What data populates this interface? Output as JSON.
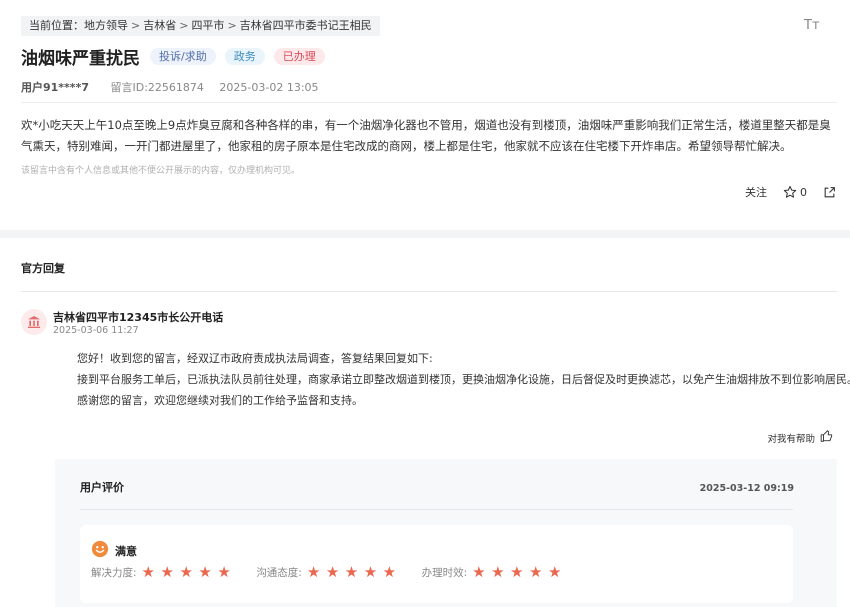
{
  "breadcrumb": {
    "prefix": "当前位置：",
    "items": [
      "地方领导",
      "吉林省",
      "四平市",
      "吉林省四平市委书记王相民"
    ],
    "separator": ">"
  },
  "toolbar": {
    "font_size_icon": "Tт"
  },
  "message": {
    "title": "油烟味严重扰民",
    "tags": {
      "type": "投诉/求助",
      "dept": "政务",
      "status": "已办理"
    },
    "user": "用户91****7",
    "message_id": "留言ID:22561874",
    "time": "2025-03-02 13:05",
    "content": "欢*小吃天天上午10点至晚上9点炸臭豆腐和各种各样的串，有一个油烟净化器也不管用，烟道也没有到楼顶，油烟味严重影响我们正常生活，楼道里整天都是臭气熏天，特别难闻，一开门都进屋里了，他家租的房子原本是住宅改成的商网，楼上都是住宅，他家就不应该在住宅楼下开炸串店。希望领导帮忙解决。",
    "privacy_note": "该留言中含有个人信息或其他不便公开展示的内容，仅办理机构可见。",
    "actions": {
      "follow": "关注",
      "like_count": "0"
    }
  },
  "official_reply": {
    "section_title": "官方回复",
    "org_name": "吉林省四平市12345市长公开电话",
    "time": "2025-03-06 11:27",
    "lines": [
      "您好！收到您的留言，经双辽市政府责成执法局调查，答复结果回复如下:",
      "接到平台服务工单后，已派执法队员前往处理，商家承诺立即整改烟道到楼顶，更换油烟净化设施，日后督促及时更换滤芯，以免产生油烟排放不到位影响居民。",
      "感谢您的留言，欢迎您继续对我们的工作给予监督和支持。"
    ],
    "helpful_label": "对我有帮助"
  },
  "evaluation": {
    "title": "用户评价",
    "time": "2025-03-12 09:19",
    "satisfaction": "满意",
    "ratings": [
      {
        "label": "解决力度:",
        "stars": 5
      },
      {
        "label": "沟通态度:",
        "stars": 5
      },
      {
        "label": "办理时效:",
        "stars": 5
      }
    ]
  },
  "colors": {
    "accent_red": "#d94b5b",
    "star": "#e9684f",
    "tag_blue": "#3c8cc1"
  }
}
